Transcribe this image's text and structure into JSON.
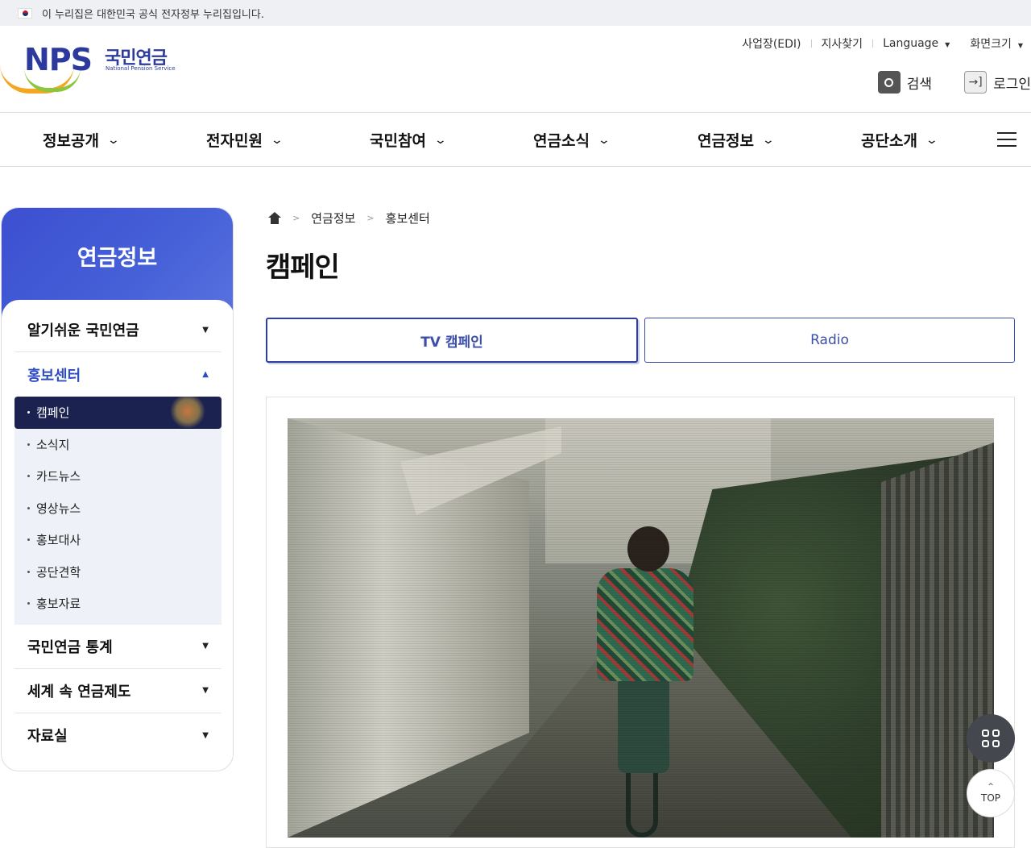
{
  "gov_banner": {
    "text": "이 누리집은 대한민국 공식 전자정부 누리집입니다."
  },
  "logo": {
    "abbr": "NPS",
    "korean": "국민연금",
    "english": "National Pension Service"
  },
  "util_links": [
    "사업장(EDI)",
    "지사찾기",
    "Language",
    "화면크기"
  ],
  "actions": {
    "search": "검색",
    "login": "로그인"
  },
  "gnb": [
    "정보공개",
    "전자민원",
    "국민참여",
    "연금소식",
    "연금정보",
    "공단소개"
  ],
  "side_menu": {
    "title": "연금정보",
    "groups": [
      {
        "label": "알기쉬운 국민연금",
        "expanded": false
      },
      {
        "label": "홍보센터",
        "expanded": true,
        "children": [
          "캠페인",
          "소식지",
          "카드뉴스",
          "영상뉴스",
          "홍보대사",
          "공단견학",
          "홍보자료"
        ],
        "selected": "캠페인"
      },
      {
        "label": "국민연금 통계",
        "expanded": false
      },
      {
        "label": "세계 속 연금제도",
        "expanded": false
      },
      {
        "label": "자료실",
        "expanded": false
      }
    ]
  },
  "breadcrumb": [
    "연금정보",
    "홍보센터"
  ],
  "page_title": "캠페인",
  "tabs": [
    {
      "label": "TV 캠페인",
      "active": true
    },
    {
      "label": "Radio",
      "active": false
    }
  ],
  "floating": {
    "top_label": "TOP"
  },
  "colors": {
    "brand_blue": "#2e4cc4",
    "side_head": "#4661d8",
    "selected_item": "#1b2250"
  }
}
